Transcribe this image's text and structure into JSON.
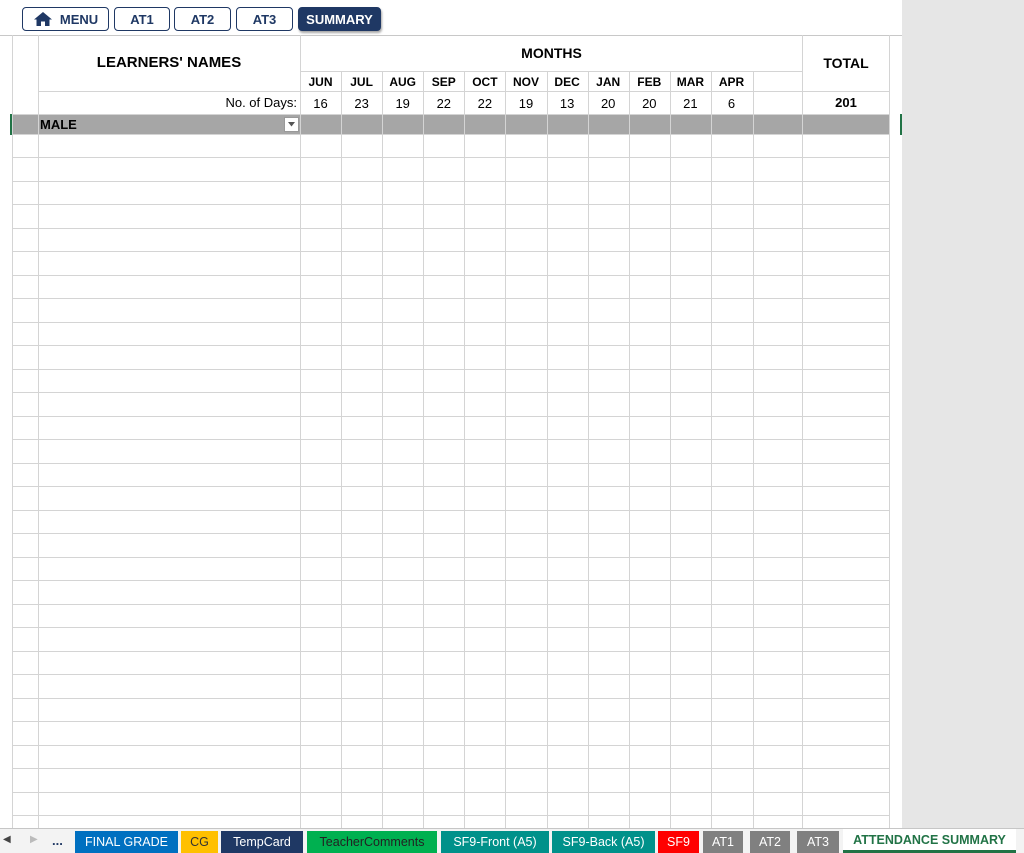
{
  "nav": {
    "buttons": [
      {
        "label": "MENU",
        "icon": "home-icon"
      },
      {
        "label": "AT1"
      },
      {
        "label": "AT2"
      },
      {
        "label": "AT3"
      },
      {
        "label": "SUMMARY",
        "active": true
      }
    ]
  },
  "table": {
    "names_header": "LEARNERS' NAMES",
    "months_header": "MONTHS",
    "total_header": "TOTAL",
    "days_label": "No. of Days:",
    "months": [
      "JUN",
      "JUL",
      "AUG",
      "SEP",
      "OCT",
      "NOV",
      "DEC",
      "JAN",
      "FEB",
      "MAR",
      "APR"
    ],
    "days": [
      "16",
      "23",
      "19",
      "22",
      "22",
      "19",
      "13",
      "20",
      "20",
      "21",
      "6"
    ],
    "total_days": "201",
    "section_label": "MALE",
    "section_color": "#a6a6a6"
  },
  "tabs": {
    "items": [
      {
        "label": "FINAL GRADE",
        "bg": "#0070c0",
        "fg": "#ffffff"
      },
      {
        "label": "CG",
        "bg": "#ffc000",
        "fg": "#333333"
      },
      {
        "label": "TempCard",
        "bg": "#1f3864",
        "fg": "#ffffff"
      },
      {
        "label": "TeacherComments",
        "bg": "#00b050",
        "fg": "#222222"
      },
      {
        "label": "SF9-Front (A5)",
        "bg": "#00918a",
        "fg": "#ffffff"
      },
      {
        "label": "SF9-Back (A5)",
        "bg": "#00918a",
        "fg": "#ffffff"
      },
      {
        "label": "SF9",
        "bg": "#ff0000",
        "fg": "#ffffff"
      },
      {
        "label": "AT1",
        "bg": "#808080",
        "fg": "#ffffff"
      },
      {
        "label": "AT2",
        "bg": "#808080",
        "fg": "#ffffff"
      },
      {
        "label": "AT3",
        "bg": "#808080",
        "fg": "#ffffff"
      },
      {
        "label": "ATTENDANCE SUMMARY",
        "active": true
      }
    ],
    "more": "..."
  },
  "colors": {
    "brand": "#1f3864",
    "excel_green": "#217346",
    "grid": "#d4d4d4"
  }
}
